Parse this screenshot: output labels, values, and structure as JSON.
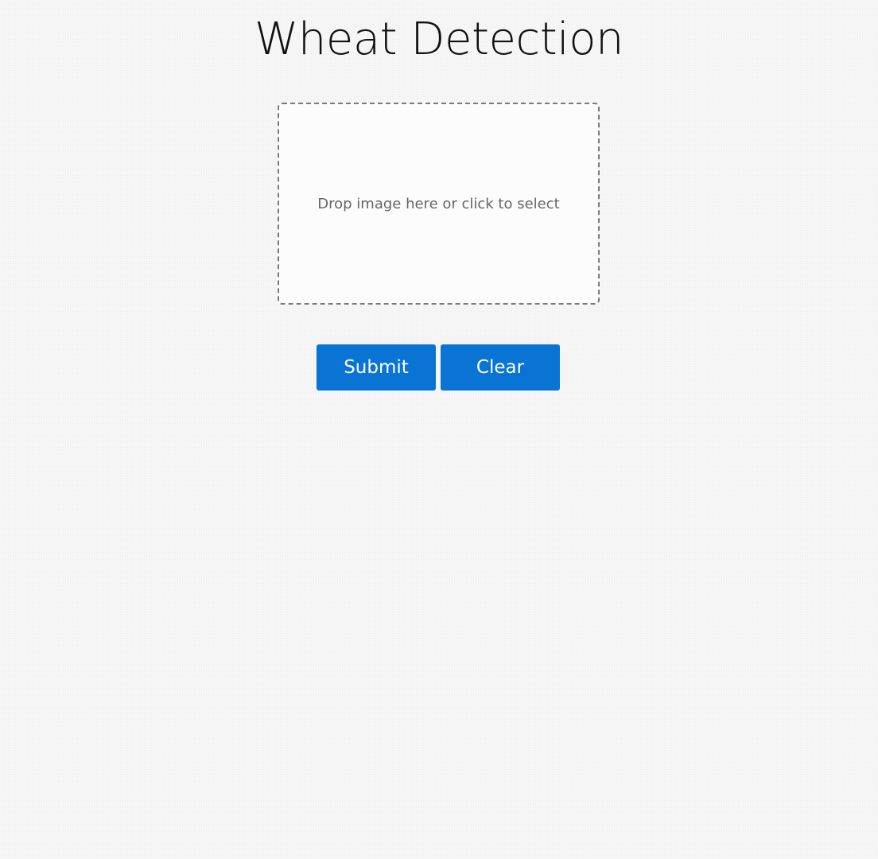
{
  "page": {
    "title": "Wheat Detection"
  },
  "dropzone": {
    "text": "Drop image here or click to select"
  },
  "buttons": {
    "submit_label": "Submit",
    "clear_label": "Clear"
  },
  "colors": {
    "button_background": "#0a74d4",
    "button_text": "#ffffff",
    "page_background": "#f6f6f6",
    "dropzone_border": "#7a7a7a"
  }
}
